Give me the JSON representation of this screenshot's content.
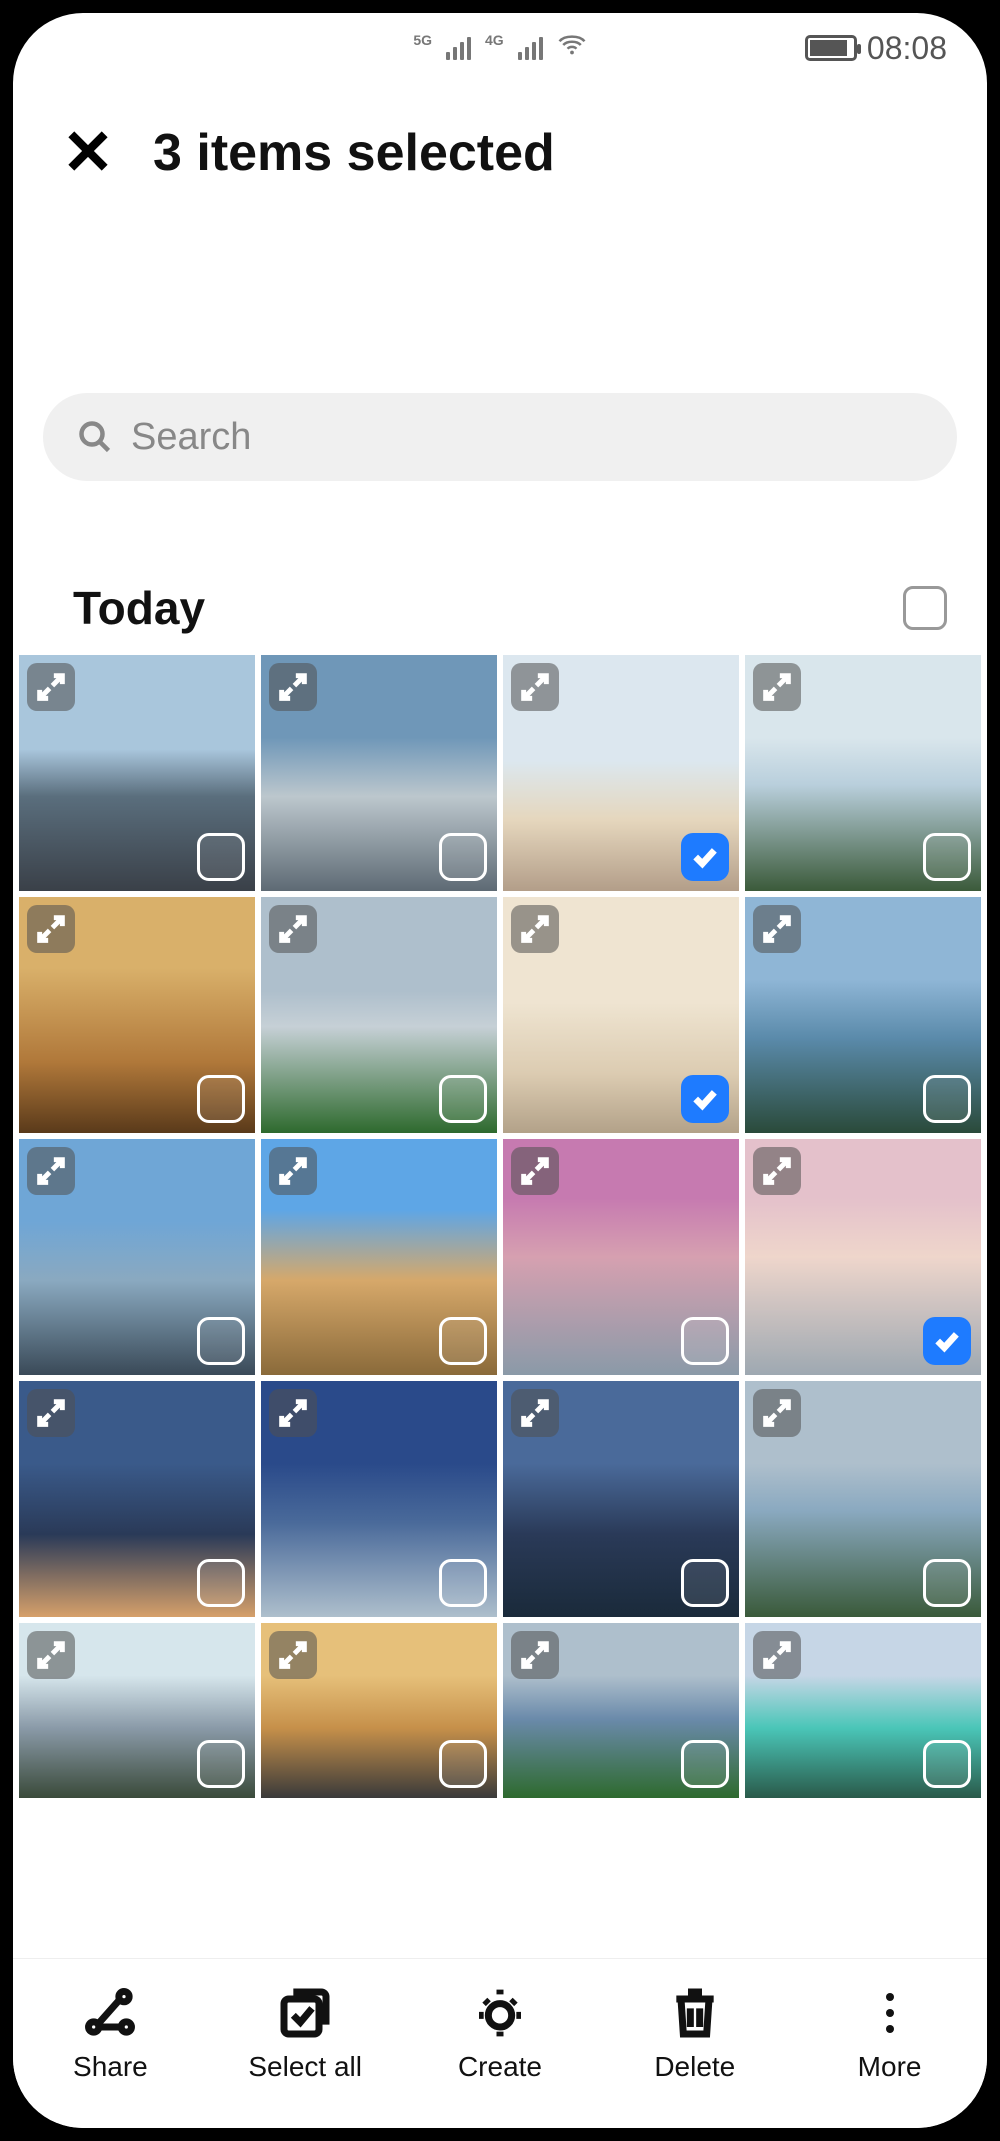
{
  "status": {
    "net1": "5G",
    "net2": "4G",
    "time": "08:08"
  },
  "header": {
    "title": "3 items selected"
  },
  "search": {
    "placeholder": "Search"
  },
  "section": {
    "title": "Today"
  },
  "photos": [
    {
      "selected": false
    },
    {
      "selected": false
    },
    {
      "selected": true
    },
    {
      "selected": false
    },
    {
      "selected": false
    },
    {
      "selected": false
    },
    {
      "selected": true
    },
    {
      "selected": false
    },
    {
      "selected": false
    },
    {
      "selected": false
    },
    {
      "selected": false
    },
    {
      "selected": true
    },
    {
      "selected": false
    },
    {
      "selected": false
    },
    {
      "selected": false
    },
    {
      "selected": false
    },
    {
      "selected": false
    },
    {
      "selected": false
    },
    {
      "selected": false
    },
    {
      "selected": false
    }
  ],
  "actions": {
    "share": "Share",
    "select_all": "Select all",
    "create": "Create",
    "delete": "Delete",
    "more": "More"
  }
}
